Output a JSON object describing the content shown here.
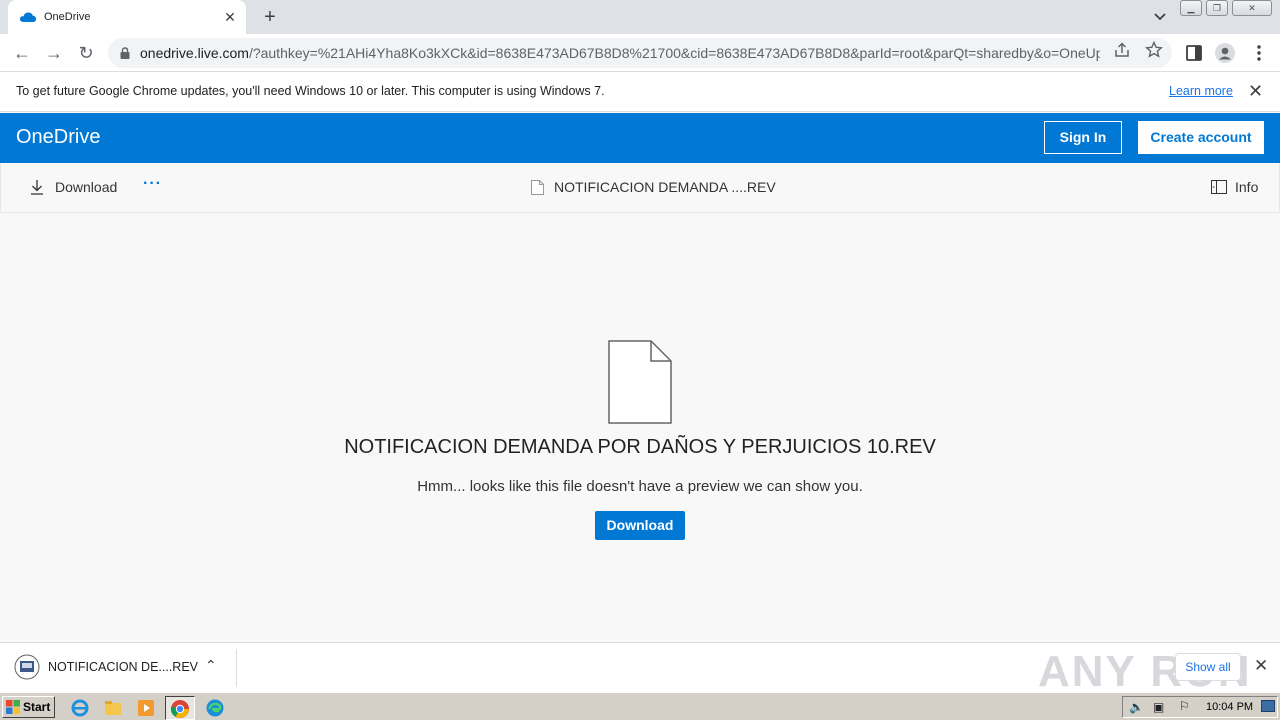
{
  "browser": {
    "tab_title": "OneDrive",
    "new_tab": "+",
    "url_host": "onedrive.live.com",
    "url_rest": "/?authkey=%21AHi4Yha8Ko3kXCk&id=8638E473AD67B8D8%21700&cid=8638E473AD67B8D8&parId=root&parQt=sharedby&o=OneUp"
  },
  "infobar": {
    "message": "To get future Google Chrome updates, you'll need Windows 10 or later. This computer is using Windows 7.",
    "learn_more": "Learn more"
  },
  "onedrive": {
    "brand": "OneDrive",
    "sign_in": "Sign In",
    "create_account": "Create account",
    "accent_color": "#0078d4"
  },
  "commandbar": {
    "download_label": "Download",
    "more_label": "···",
    "file_label": "NOTIFICACION DEMANDA ....REV",
    "info_label": "Info"
  },
  "content": {
    "file_name": "NOTIFICACION DEMANDA POR DAÑOS Y PERJUICIOS 10.REV",
    "no_preview": "Hmm... looks like this file doesn't have a preview we can show you.",
    "download_button": "Download"
  },
  "shelf": {
    "item_name": "NOTIFICACION DE....REV",
    "show_all": "Show all",
    "watermark": "ANY RUN"
  },
  "taskbar": {
    "start_label": "Start",
    "clock": "10:04 PM"
  }
}
